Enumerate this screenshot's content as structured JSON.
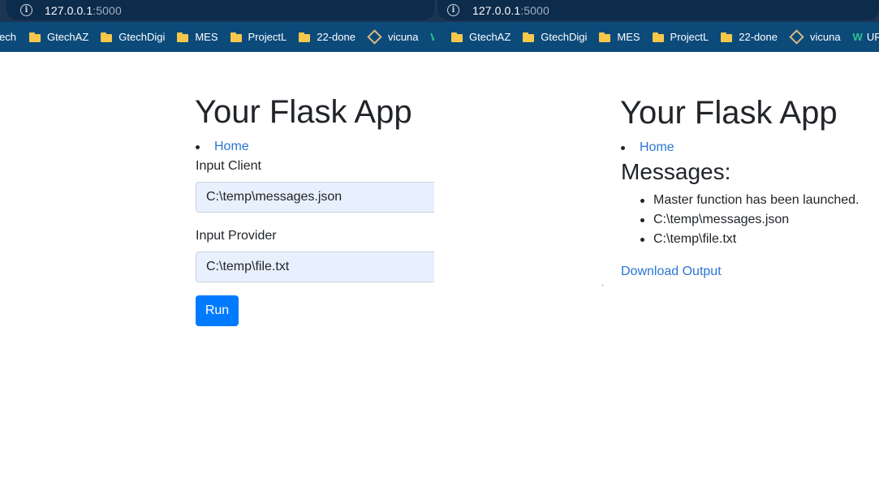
{
  "browser": {
    "url_host": "127.0.0.1",
    "url_port": ":5000",
    "left_bookmarks": [
      {
        "label": "ech",
        "icon": "none"
      },
      {
        "label": "GtechAZ",
        "icon": "folder-icon"
      },
      {
        "label": "GtechDigi",
        "icon": "folder-icon"
      },
      {
        "label": "MES",
        "icon": "folder-icon"
      },
      {
        "label": "ProjectL",
        "icon": "folder-icon"
      },
      {
        "label": "22-done",
        "icon": "folder-icon"
      },
      {
        "label": "vicuna",
        "icon": "vicuna-icon"
      },
      {
        "label": "W",
        "icon": "w-icon"
      }
    ],
    "right_bookmarks": [
      {
        "label": "GtechAZ",
        "icon": "folder-icon"
      },
      {
        "label": "GtechDigi",
        "icon": "folder-icon"
      },
      {
        "label": "MES",
        "icon": "folder-icon"
      },
      {
        "label": "ProjectL",
        "icon": "folder-icon"
      },
      {
        "label": "22-done",
        "icon": "folder-icon"
      },
      {
        "label": "vicuna",
        "icon": "vicuna-icon"
      },
      {
        "label": "URL",
        "icon": "w-icon"
      }
    ]
  },
  "left_page": {
    "title": "Your Flask App",
    "nav": {
      "home": "Home"
    },
    "form": {
      "client_label": "Input Client",
      "client_value": "C:\\temp\\messages.json",
      "provider_label": "Input Provider",
      "provider_value": "C:\\temp\\file.txt",
      "run_label": "Run"
    }
  },
  "right_page": {
    "title": "Your Flask App",
    "nav": {
      "home": "Home"
    },
    "messages_heading": "Messages:",
    "messages": [
      "Master function has been launched.",
      "C:\\temp\\messages.json",
      "C:\\temp\\file.txt"
    ],
    "download_label": "Download Output"
  },
  "colors": {
    "chrome_dark": "#0d2b4b",
    "bookmark_bar": "#0c4a7a",
    "link": "#2a76d3",
    "primary_button": "#007bff",
    "autofill_input": "#e8f0fe"
  }
}
